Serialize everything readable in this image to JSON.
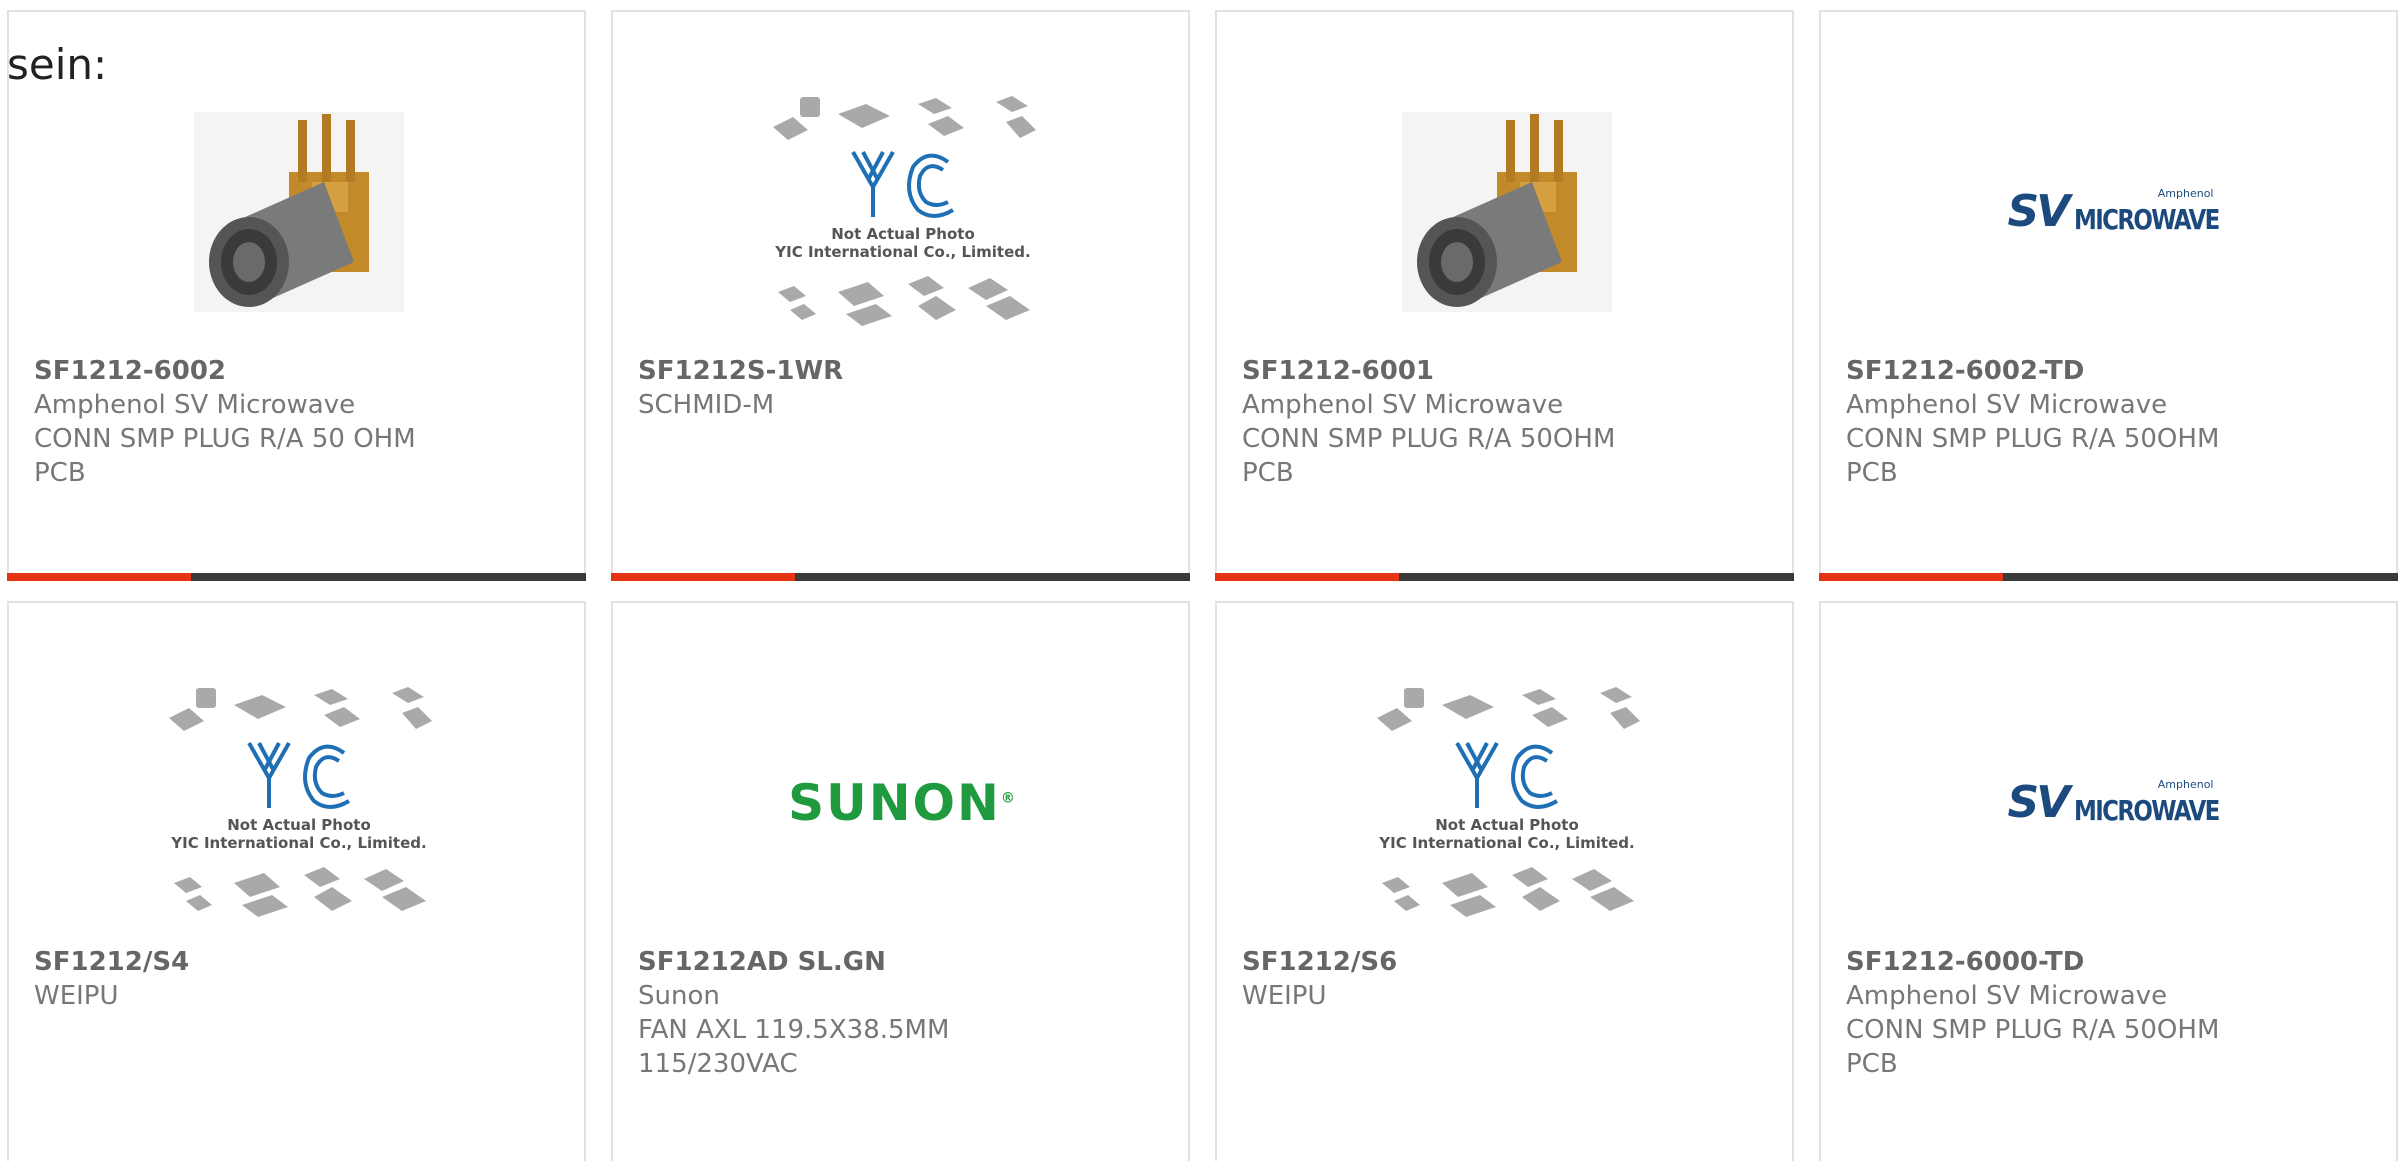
{
  "heading_fragment": "sein:",
  "colors": {
    "accent": "#e63312",
    "bar": "#3a3a3a",
    "border": "#e2e2e2"
  },
  "placeholder": {
    "line1": "Not Actual Photo",
    "line2": "YIC International Co., Limited."
  },
  "logos": {
    "sv": {
      "sv": "SV",
      "word": "MICROWAVE",
      "brand": "Amphenol"
    },
    "sunon": {
      "word": "SUNON",
      "mark": "®"
    }
  },
  "products": [
    {
      "image": "smp-connector-photo",
      "part_no": "SF1212-6002",
      "manufacturer": "Amphenol SV Microwave",
      "description": "CONN SMP PLUG R/A 50 OHM PCB"
    },
    {
      "image": "yic-placeholder",
      "part_no": "SF1212S-1WR",
      "manufacturer": "SCHMID-M",
      "description": ""
    },
    {
      "image": "smp-connector-photo",
      "part_no": "SF1212-6001",
      "manufacturer": "Amphenol SV Microwave",
      "description": "CONN SMP PLUG R/A 50OHM PCB"
    },
    {
      "image": "sv-microwave-logo",
      "part_no": "SF1212-6002-TD",
      "manufacturer": "Amphenol SV Microwave",
      "description": "CONN SMP PLUG R/A 50OHM PCB"
    },
    {
      "image": "yic-placeholder",
      "part_no": "SF1212/S4",
      "manufacturer": "WEIPU",
      "description": ""
    },
    {
      "image": "sunon-logo",
      "part_no": "SF1212AD SL.GN",
      "manufacturer": "Sunon",
      "description": "FAN AXL 119.5X38.5MM 115/230VAC"
    },
    {
      "image": "yic-placeholder",
      "part_no": "SF1212/S6",
      "manufacturer": "WEIPU",
      "description": ""
    },
    {
      "image": "sv-microwave-logo",
      "part_no": "SF1212-6000-TD",
      "manufacturer": "Amphenol SV Microwave",
      "description": "CONN SMP PLUG R/A 50OHM PCB"
    }
  ]
}
